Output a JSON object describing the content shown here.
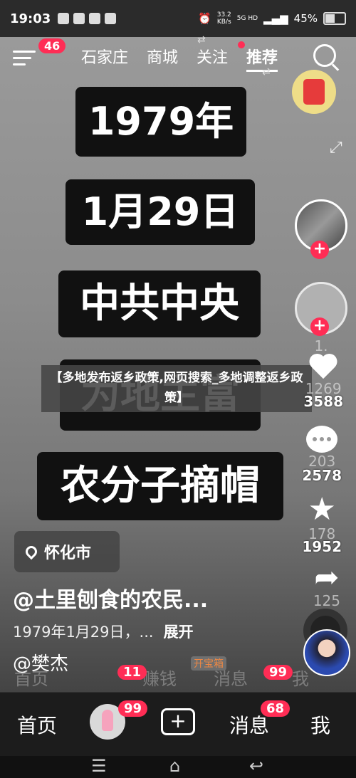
{
  "status_bar": {
    "time": "19:03",
    "net_speed": "33.2",
    "net_unit": "KB/s",
    "net_type": "5G HD",
    "battery": "45%",
    "battery_level": 0.45
  },
  "top_nav": {
    "menu_badge": "46",
    "tabs": [
      "石家庄",
      "商城",
      "关注",
      "推荐"
    ],
    "active_tab": "推荐"
  },
  "video": {
    "captions": [
      "1979年",
      "1月29日",
      "中共中央",
      "为地主富",
      "农分子摘帽"
    ],
    "overlay_title": "【多地发布返乡政策,网页搜索_多地调整返乡政策】",
    "location": "怀化市",
    "author": "@土里刨食的农民...",
    "description": "1979年1月29日，...",
    "expand_label": "展开",
    "mention": "@樊杰"
  },
  "side_actions": {
    "likes": "3588",
    "likes_ghost": "1269",
    "comments": "2578",
    "comments_ghost": "203",
    "favorites": "1952",
    "favorites_ghost": "178",
    "shares_ghost": "125",
    "follow_count_ghost": "1."
  },
  "ghost_row": {
    "items": [
      "首页",
      "赚钱",
      "消息",
      "我"
    ],
    "badges": [
      "11",
      "99"
    ],
    "tag": "开宝箱"
  },
  "bottom_nav": {
    "home": "首页",
    "friends_badge": "99",
    "messages": "消息",
    "messages_badge": "68",
    "me": "我"
  }
}
